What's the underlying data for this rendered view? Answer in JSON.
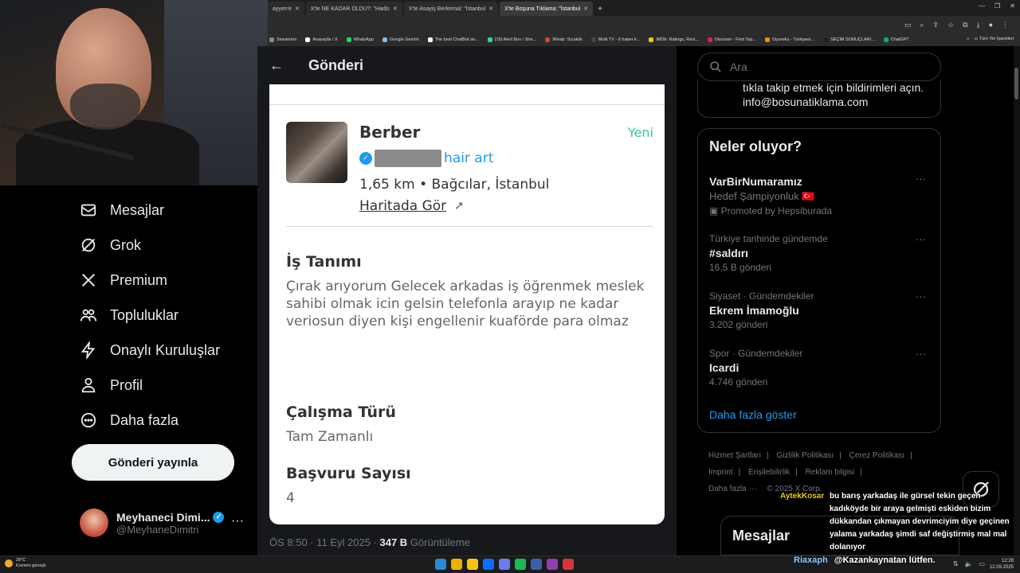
{
  "browser": {
    "tabs": [
      {
        "label": "ayyen'e"
      },
      {
        "label": "X'te NE KADAR OLDU?: \"Hadis"
      },
      {
        "label": "X'te Asayiş Berkemal: \"İstanbul"
      },
      {
        "label": "X'te Boşuna Tıklama: \"İstanbul"
      }
    ],
    "bookmarks": [
      {
        "label": "Streamers",
        "color": "#888888"
      },
      {
        "label": "Anasayfa / X",
        "color": "#ffffff"
      },
      {
        "label": "WhatsApp",
        "color": "#25d366"
      },
      {
        "label": "Google Gemini",
        "color": "#8ab4f8"
      },
      {
        "label": "The best ChatBot an...",
        "color": "#ffffff"
      },
      {
        "label": "(19) Alert Box / Stre...",
        "color": "#3ad29f"
      },
      {
        "label": "Windy: Sıcaklık",
        "color": "#e23b3b"
      },
      {
        "label": "Multi TV - 6 haber k...",
        "color": "#444444"
      },
      {
        "label": "IMDb: Ratings, Revi...",
        "color": "#f5c518"
      },
      {
        "label": "Discover - Find Top...",
        "color": "#e01e5a"
      },
      {
        "label": "Oyuneks - Türkiyeni...",
        "color": "#ff8800"
      },
      {
        "label": "SEÇİM SONUÇLARI...",
        "color": "#222222"
      },
      {
        "label": "ChatGPT",
        "color": "#10a37f"
      }
    ],
    "bookmarks_more": "»",
    "all_bookmarks": "Tüm Yer İşaretleri"
  },
  "nav": {
    "items": [
      {
        "label": "Mesajlar",
        "icon": "envelope-icon"
      },
      {
        "label": "Grok",
        "icon": "grok-icon"
      },
      {
        "label": "Premium",
        "icon": "x-logo-icon"
      },
      {
        "label": "Topluluklar",
        "icon": "communities-icon"
      },
      {
        "label": "Onaylı Kuruluşlar",
        "icon": "lightning-icon"
      },
      {
        "label": "Profil",
        "icon": "person-icon"
      },
      {
        "label": "Daha fazla",
        "icon": "more-circle-icon"
      }
    ],
    "post_button": "Gönderi yayınla",
    "profile": {
      "name": "Meyhaneci Dimi...",
      "handle": "@MeyhaneDimitri",
      "more": "···"
    }
  },
  "header": {
    "back": "←",
    "title": "Gönderi"
  },
  "job": {
    "title": "Berber",
    "badge": "Yeni",
    "company_suffix": "hair art",
    "location": "1,65 km • Bağcılar, İstanbul",
    "map_link": "Haritada Gör",
    "map_arrow": "➚",
    "sections": [
      {
        "heading": "İş Tanımı",
        "text": "Çırak arıyorum Gelecek arkadas iş öğrenmek meslek sahibi olmak icin gelsin telefonla arayıp ne kadar veriosun diyen kişi engellenir kuaförde para olmaz"
      },
      {
        "heading": "Çalışma Türü",
        "text": "Tam Zamanlı"
      },
      {
        "heading": "Başvuru Sayısı",
        "text": "4"
      }
    ]
  },
  "post_meta": {
    "time": "ÖS 8:50 · 11 Eyl 2025 · ",
    "views": "347 B",
    "views_label": " Görüntüleme"
  },
  "search": {
    "placeholder": "Ara"
  },
  "info_box": {
    "line1": "tıkla takip etmek için bildirimleri açın.",
    "line2": "info@bosunatiklama.com"
  },
  "trends": {
    "title": "Neler oluyor?",
    "items": [
      {
        "meta": "",
        "name": "VarBirNumaramız",
        "sub": "Hedef Şampiyonluk 🇹🇷",
        "sub2": "Promoted by Hepsiburada"
      },
      {
        "meta": "Türkiye tarihinde gündemde",
        "name": "#saldırı",
        "sub": "16,5 B gönderi"
      },
      {
        "meta": "Siyaset · Gündemdekiler",
        "name": "Ekrem İmamoğlu",
        "sub": "3.202 gönderi"
      },
      {
        "meta": "Spor · Gündemdekiler",
        "name": "Icardi",
        "sub": "4.746 gönderi"
      }
    ],
    "more_dots": "···",
    "show_more": "Daha fazla göster"
  },
  "footer": {
    "links": [
      "Hizmet Şartları",
      "Gizlilik Politikası",
      "Çerez Politikası",
      "Imprint",
      "Erişilebilirlik",
      "Reklam bilgisi",
      "Daha fazla ···"
    ],
    "copyright": "© 2025 X Corp."
  },
  "messages_drawer": "Mesajlar",
  "chat": {
    "msg1_user": "AytekKosar",
    "msg1_text": "bu barış yarkadaş ile gürsel tekin geçen kadıköyde bir araya gelmişti eskiden bizim dükkandan çıkmayan devrimciyim diye geçinen yalama yarkadaş şimdi saf değiştirmiş mal mal dolanıyor",
    "msg2_user": "Riaxaph",
    "msg2_text": "@Kazankaynatan lütfen."
  },
  "taskbar": {
    "weather_temp": "28°C",
    "weather_desc": "Kısmen güneşli",
    "time": "12:28",
    "date": "12.09.2025"
  },
  "colors": {
    "accent": "#1d9bf0",
    "new_badge": "#36c5a0",
    "chat_user": "#f0c419"
  }
}
